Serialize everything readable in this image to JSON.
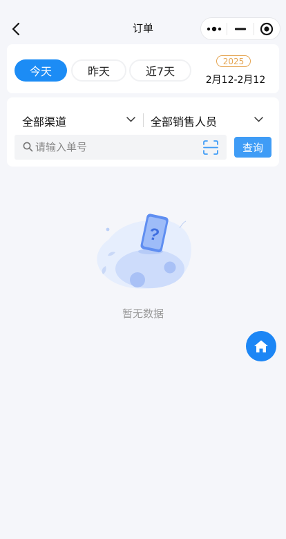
{
  "nav": {
    "title": "订单",
    "back_icon": "chevron-left-icon",
    "capsule": {
      "more_icon": "more-dots-icon",
      "minimize_icon": "minus-icon",
      "close_icon": "target-circle-icon"
    }
  },
  "date_filter": {
    "chips": [
      {
        "label": "今天",
        "active": true
      },
      {
        "label": "昨天",
        "active": false
      },
      {
        "label": "近7天",
        "active": false
      }
    ],
    "year": "2025",
    "range": "2月12-2月12"
  },
  "filters": {
    "channel": "全部渠道",
    "salesperson": "全部销售人员",
    "search_placeholder": "请输入单号",
    "search_value": "",
    "query_label": "查询"
  },
  "empty_state": {
    "text": "暂无数据",
    "icon": "empty-phone-question-illustration"
  },
  "fab": {
    "icon": "home-icon"
  },
  "colors": {
    "primary": "#1c8cf5",
    "query_button": "#3f9cf6",
    "year_badge": "#e5a552",
    "background": "#f5f6fa",
    "muted_text": "#9a9a9a"
  }
}
